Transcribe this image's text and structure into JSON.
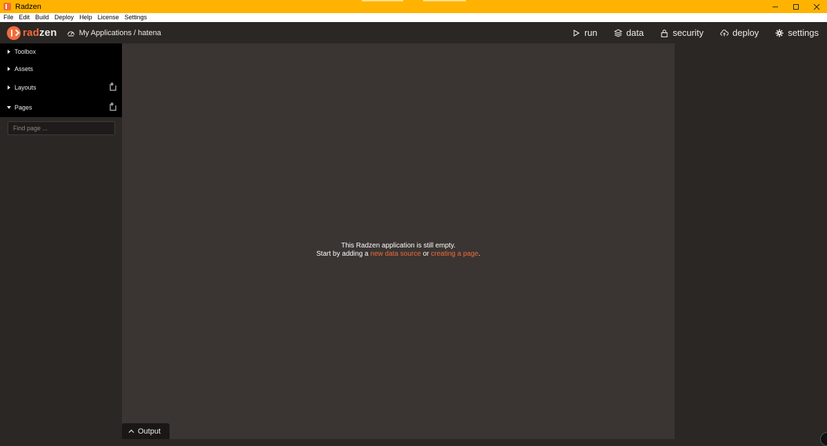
{
  "window": {
    "title": "Radzen"
  },
  "menubar": {
    "items": [
      "File",
      "Edit",
      "Build",
      "Deploy",
      "Help",
      "License",
      "Settings"
    ]
  },
  "header": {
    "logo_prefix": "rad",
    "logo_suffix": "zen",
    "breadcrumb": "My Applications / hatena",
    "nav": {
      "run": "run",
      "data": "data",
      "security": "security",
      "deploy": "deploy",
      "settings": "settings"
    }
  },
  "sidebar": {
    "sections": {
      "toolbox": "Toolbox",
      "assets": "Assets",
      "layouts": "Layouts",
      "pages": "Pages"
    },
    "search_placeholder": "Find page ..."
  },
  "canvas": {
    "line1": "This Radzen application is still empty.",
    "line2_start": "Start by adding a ",
    "link_data_source": "new data source",
    "line2_mid": " or ",
    "link_create_page": "creating a page",
    "line2_end": "."
  },
  "output": {
    "label": "Output"
  },
  "colors": {
    "titlebar": "#ffb300",
    "accent": "#f26b3a",
    "header_bg": "#2b2725",
    "canvas_bg": "#3a3532"
  }
}
